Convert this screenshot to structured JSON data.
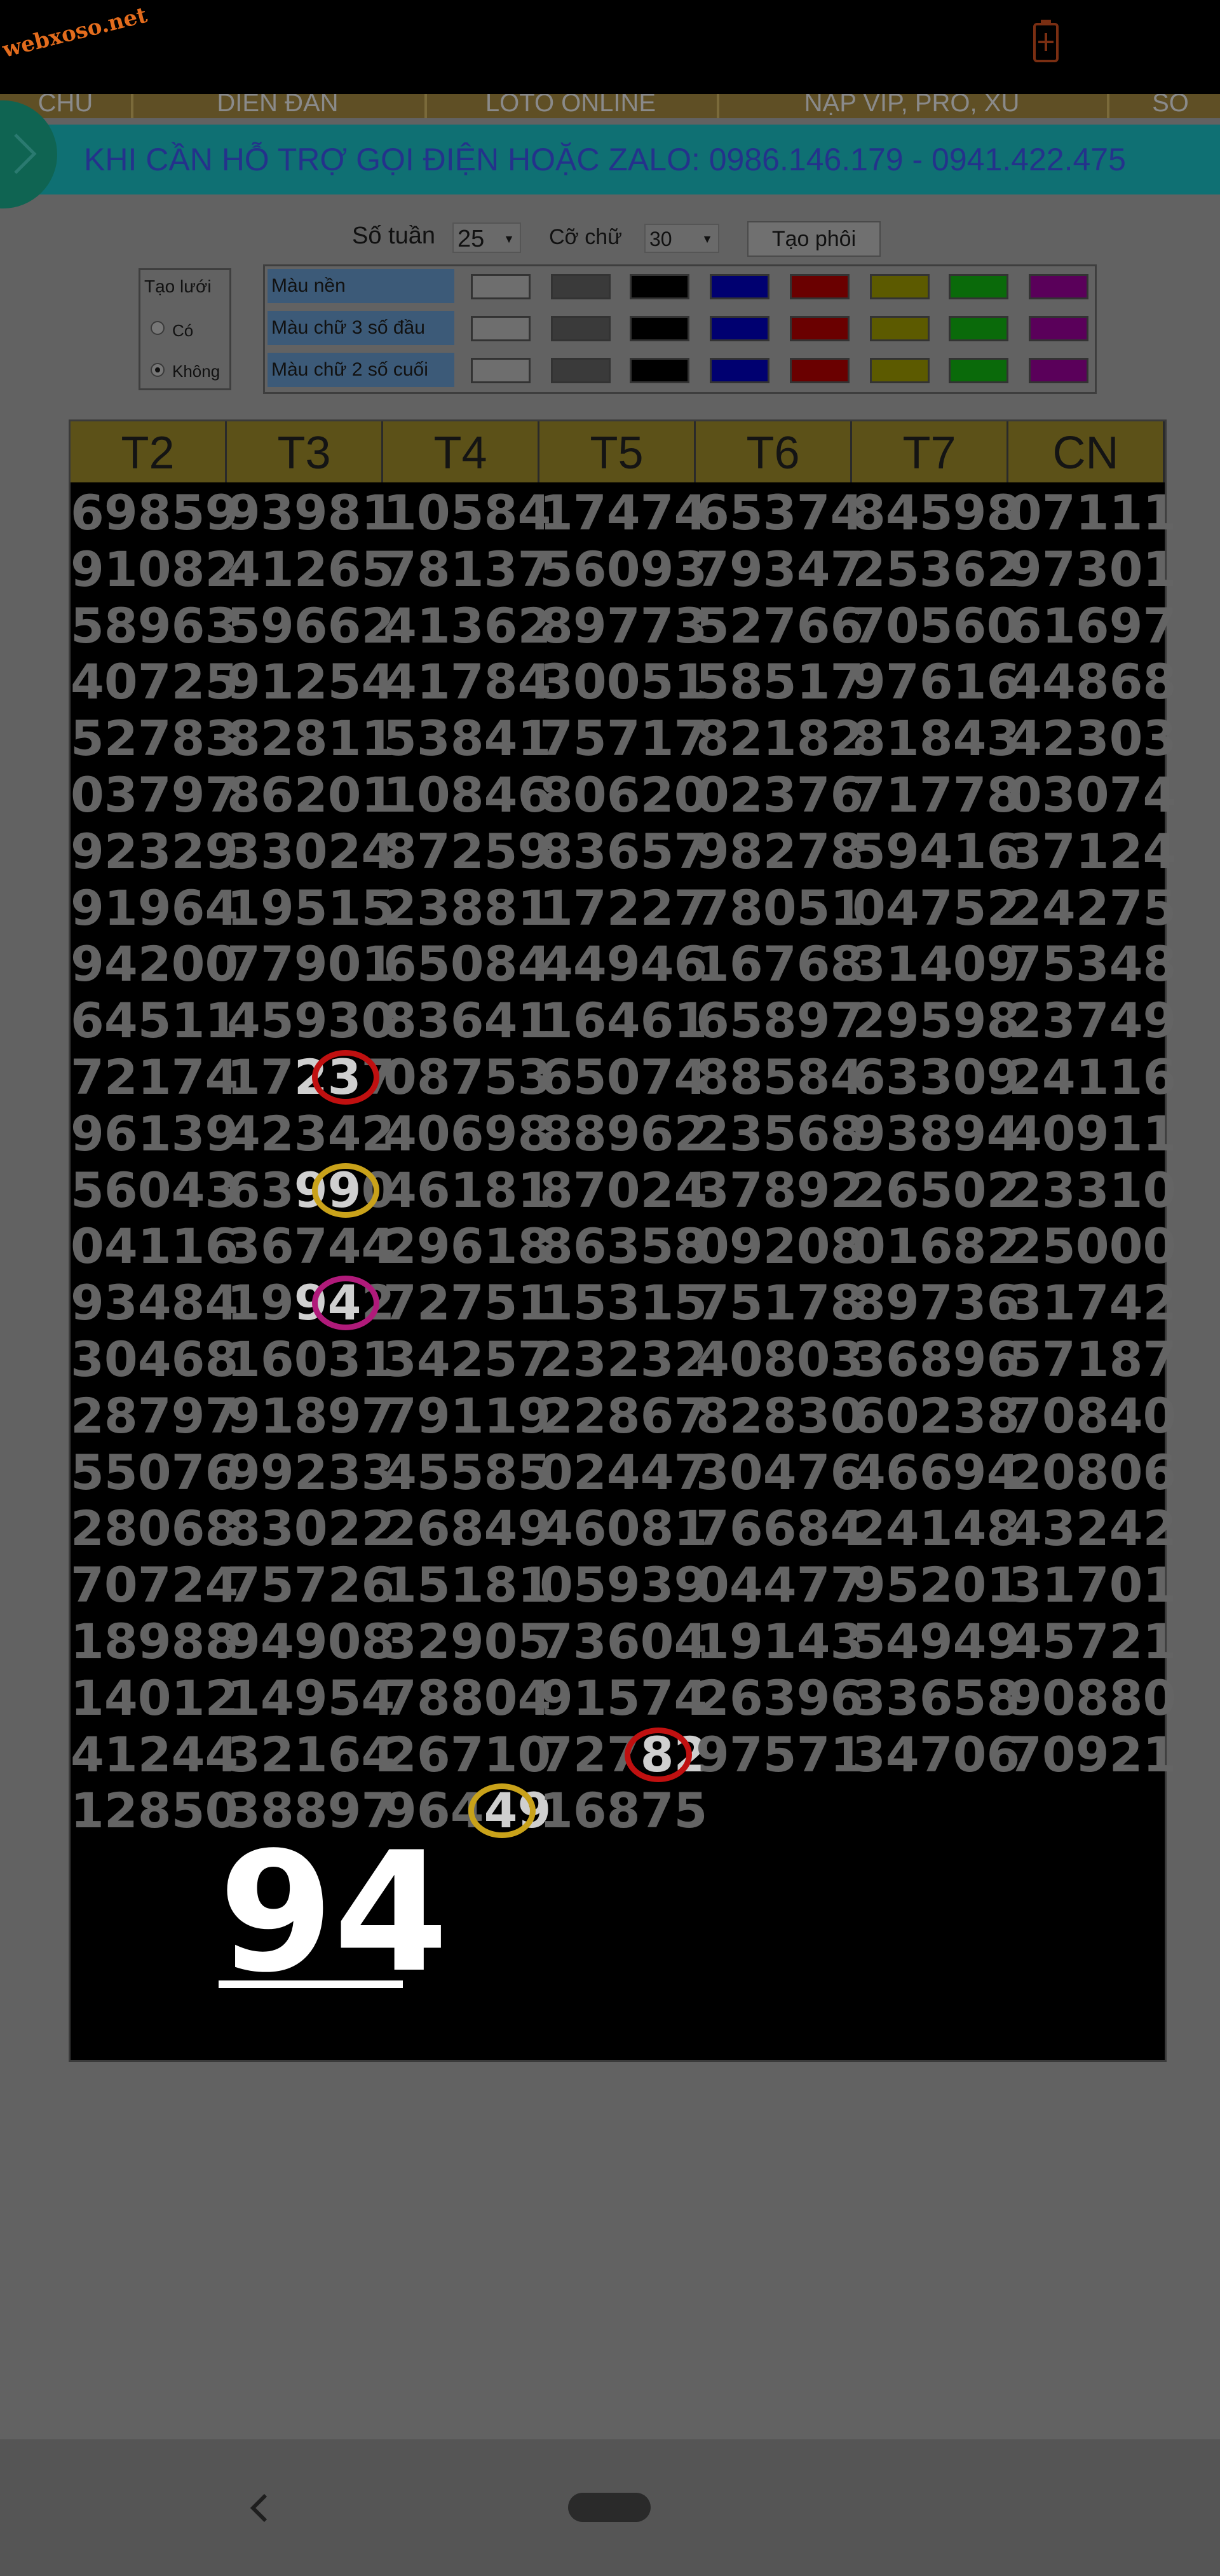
{
  "watermark": "webxoso.net",
  "status_icons": [
    "battery-icon"
  ],
  "navbar": {
    "items": [
      "CHỦ",
      "DIỄN ĐÀN",
      "LOTO ONLINE",
      "NẠP VIP, PRO, XU",
      "SO"
    ]
  },
  "banner": {
    "text": "KHI CẦN HỖ TRỢ GỌI ĐIỆN HOẶC ZALO: 0986.146.179 - 0941.422.475"
  },
  "controls": {
    "weeks_label": "Số tuần",
    "weeks_value": "25",
    "font_label": "Cỡ chữ",
    "font_value": "30",
    "create_button": "Tạo phôi",
    "grid_title": "Tạo lưới",
    "grid_yes": "Có",
    "grid_no": "Không",
    "grid_selected": "Không"
  },
  "color_rows": [
    {
      "label": "Màu nền"
    },
    {
      "label": "Màu chữ 3 số đầu"
    },
    {
      "label": "Màu chữ 2 số cuối"
    }
  ],
  "swatch_colors": [
    "#6e6e6e",
    "#3a3a3a",
    "#000000",
    "#000070",
    "#6a0000",
    "#5c5a00",
    "#0a6a0a",
    "#5a005a"
  ],
  "board": {
    "days": [
      "T2",
      "T3",
      "T4",
      "T5",
      "T6",
      "T7",
      "CN"
    ],
    "rows": [
      [
        "69859",
        "93981",
        "10584",
        "17474",
        "65374",
        "84598",
        "07111"
      ],
      [
        "91082",
        "41265",
        "78137",
        "56093",
        "79347",
        "25362",
        "97301"
      ],
      [
        "58963",
        "59662",
        "41362",
        "89773",
        "52766",
        "70560",
        "61697"
      ],
      [
        "40725",
        "91254",
        "41784",
        "30051",
        "58517",
        "97616",
        "44868"
      ],
      [
        "52783",
        "82811",
        "53841",
        "75717",
        "82182",
        "81843",
        "42303"
      ],
      [
        "03797",
        "86201",
        "10846",
        "80620",
        "02376",
        "71778",
        "03074"
      ],
      [
        "92329",
        "33024",
        "87259",
        "83657",
        "98278",
        "59416",
        "37124"
      ],
      [
        "91964",
        "19515",
        "23881",
        "17227",
        "78051",
        "04752",
        "24275"
      ],
      [
        "94200",
        "77901",
        "65084",
        "44946",
        "16768",
        "31409",
        "75348"
      ],
      [
        "64511",
        "45930",
        "83641",
        "16461",
        "65897",
        "29598",
        "23749"
      ],
      [
        "72174",
        "17237",
        "08753",
        "65074",
        "88584",
        "63309",
        "24116"
      ],
      [
        "96139",
        "42342",
        "40698",
        "88962",
        "23568",
        "93894",
        "40911"
      ],
      [
        "56043",
        "63990",
        "46181",
        "87024",
        "37892",
        "26502",
        "23310"
      ],
      [
        "04116",
        "36744",
        "29618",
        "86358",
        "09208",
        "01682",
        "25000"
      ],
      [
        "93484",
        "19942",
        "72751",
        "15315",
        "75178",
        "89736",
        "31742"
      ],
      [
        "30468",
        "16031",
        "34257",
        "23232",
        "40803",
        "36896",
        "57187"
      ],
      [
        "28797",
        "91897",
        "79119",
        "22867",
        "82830",
        "60238",
        "70840"
      ],
      [
        "55076",
        "99233",
        "45585",
        "02447",
        "30476",
        "46694",
        "20806"
      ],
      [
        "28068",
        "83022",
        "26849",
        "46081",
        "76684",
        "24148",
        "43242"
      ],
      [
        "70724",
        "75726",
        "15181",
        "05939",
        "04477",
        "95201",
        "31701"
      ],
      [
        "18988",
        "94908",
        "32905",
        "73604",
        "19143",
        "54949",
        "45721"
      ],
      [
        "14012",
        "14954",
        "78804",
        "91574",
        "26396",
        "33658",
        "90880"
      ],
      [
        "41244",
        "32164",
        "26710",
        "72782",
        "97571",
        "34706",
        "70921"
      ],
      [
        "12850",
        "38897",
        "96449",
        "16875",
        "",
        "",
        ""
      ]
    ],
    "highlights": [
      {
        "row": 10,
        "col": 1,
        "digits": "23",
        "color": "#c01010"
      },
      {
        "row": 12,
        "col": 1,
        "digits": "99",
        "color": "#c9a21a"
      },
      {
        "row": 14,
        "col": 1,
        "digits": "94",
        "color": "#b01a7a"
      },
      {
        "row": 22,
        "col": 3,
        "digits": "82",
        "color": "#c01010"
      },
      {
        "row": 23,
        "col": 2,
        "digits": "49",
        "color": "#c9a21a"
      }
    ],
    "prediction": "94"
  }
}
